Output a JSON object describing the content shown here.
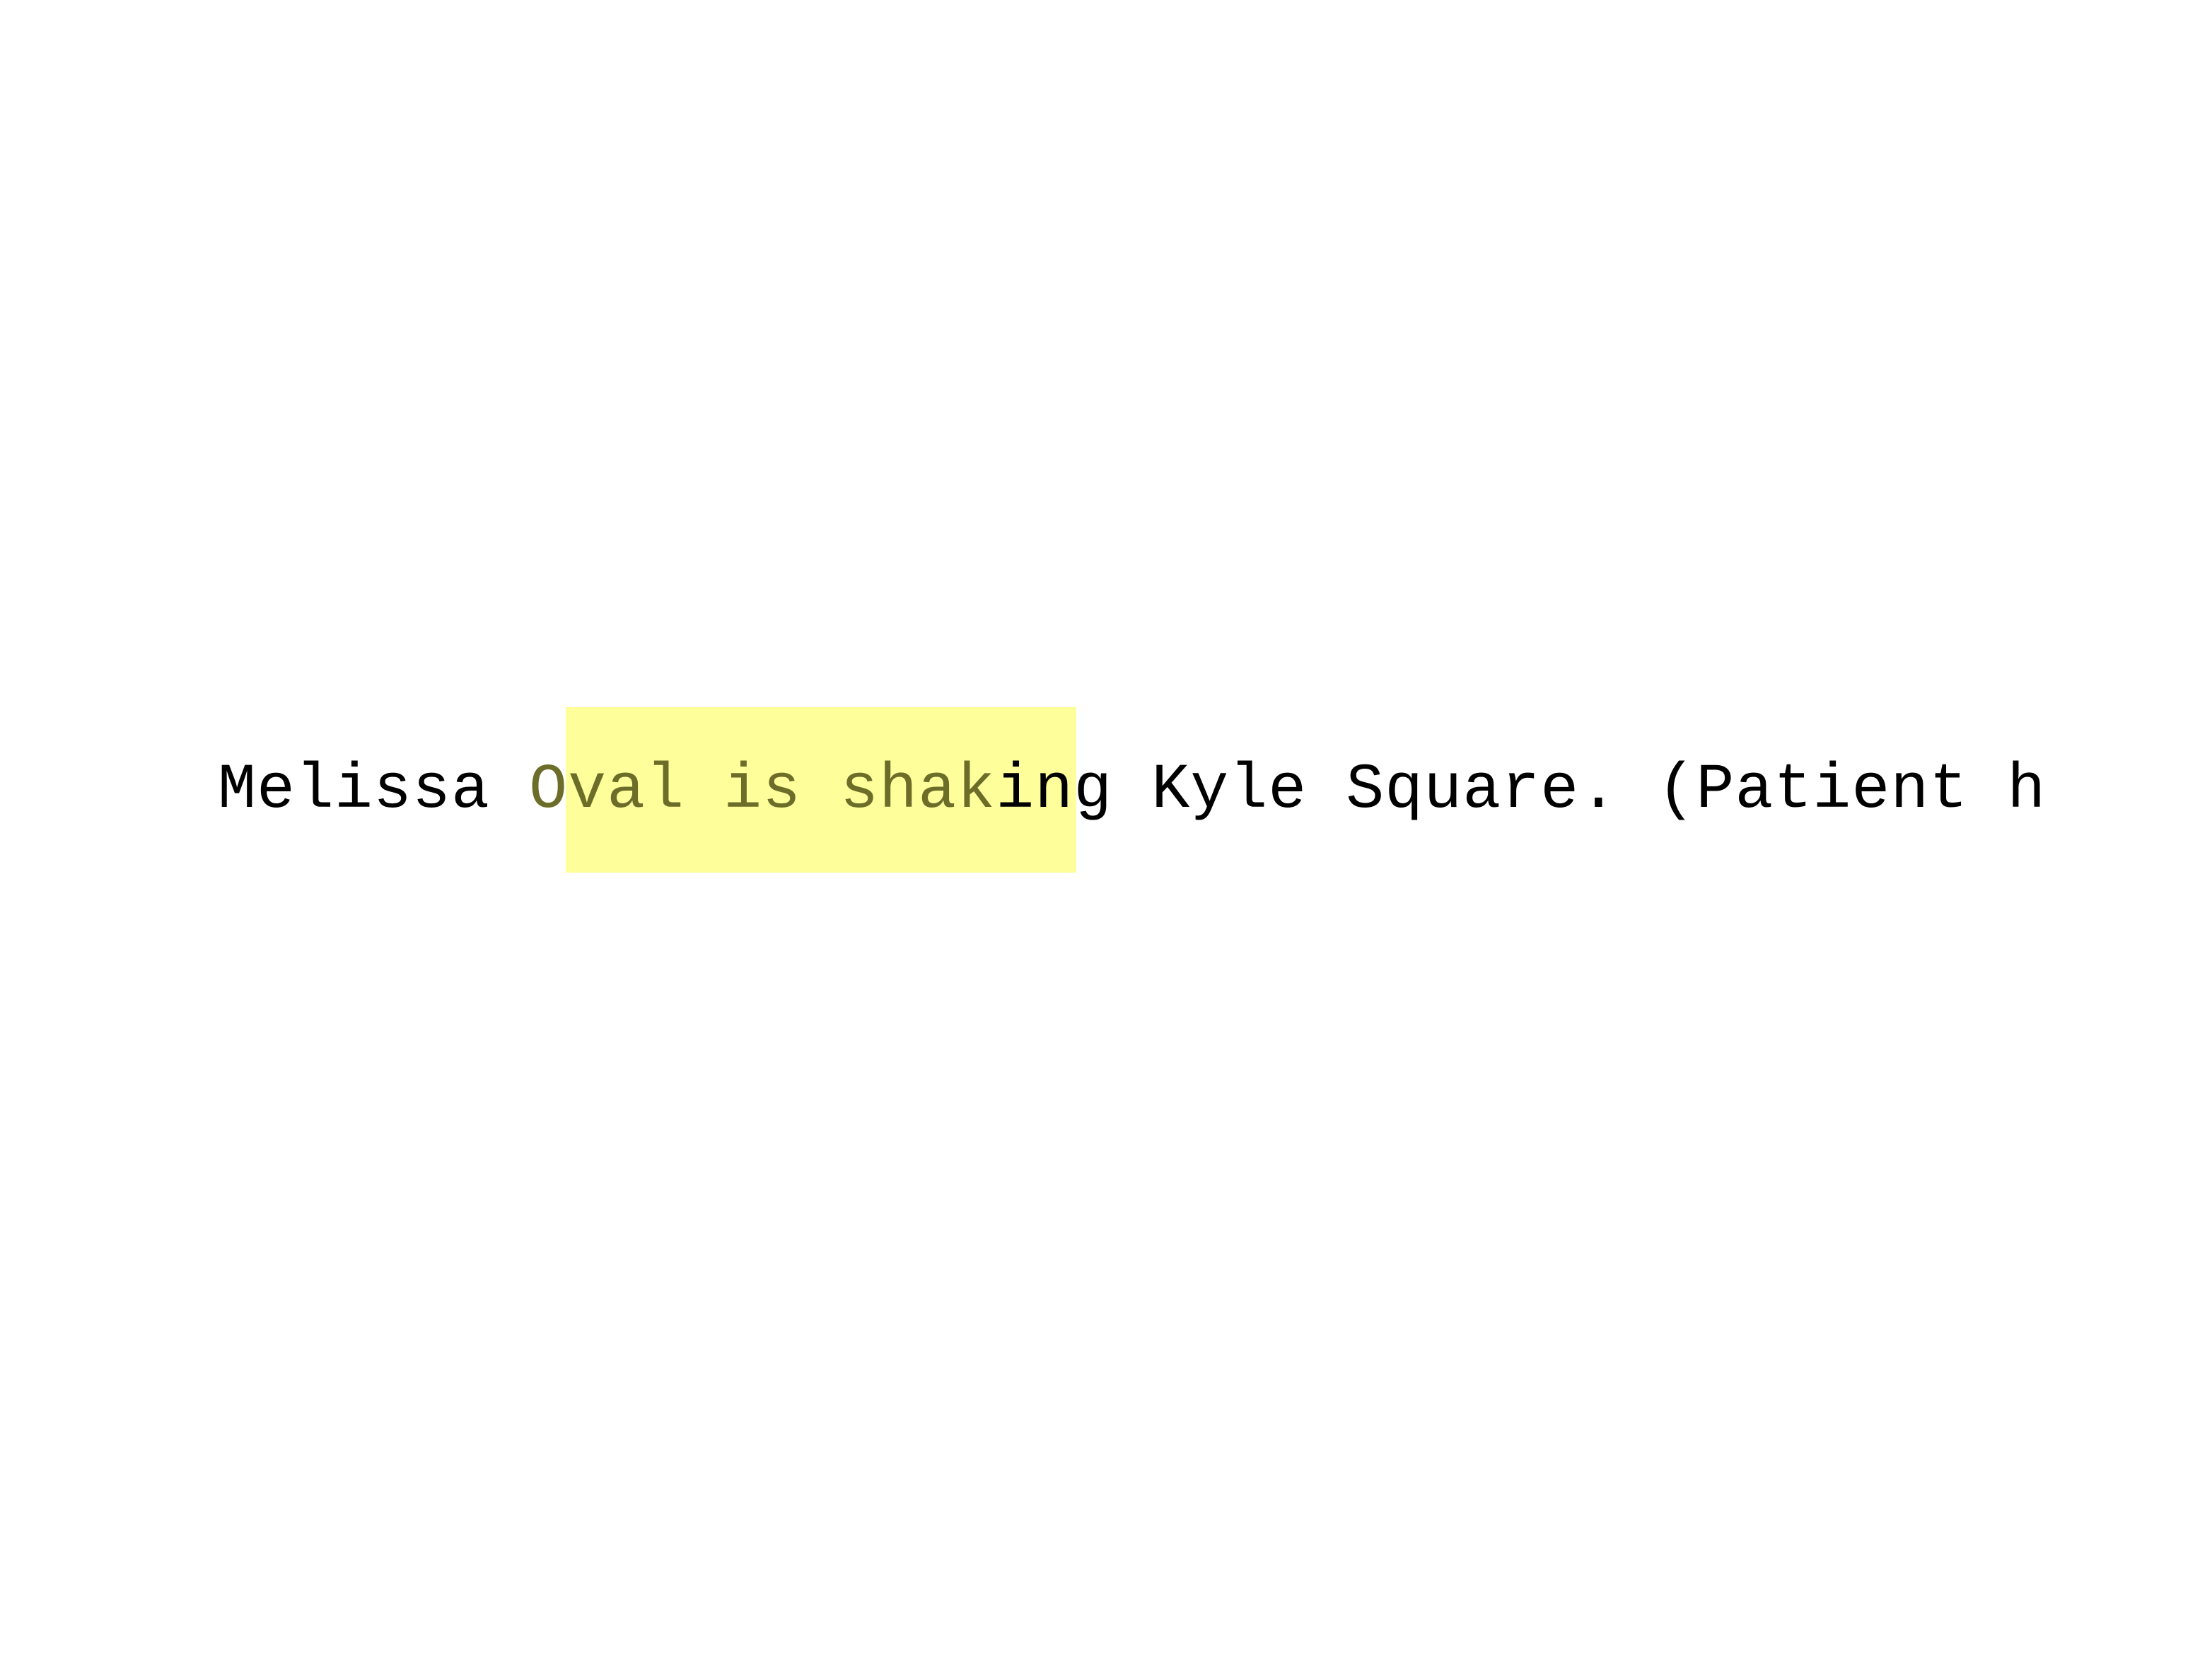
{
  "document": {
    "text_before": "Melissa ",
    "text_highlighted": "Oval is shak",
    "text_after": "ing Kyle Square. (Patient h"
  },
  "colors": {
    "background": "#ffffff",
    "highlight": "#fefe99",
    "text": "#000000",
    "highlighted_text": "#6d6d2a"
  }
}
